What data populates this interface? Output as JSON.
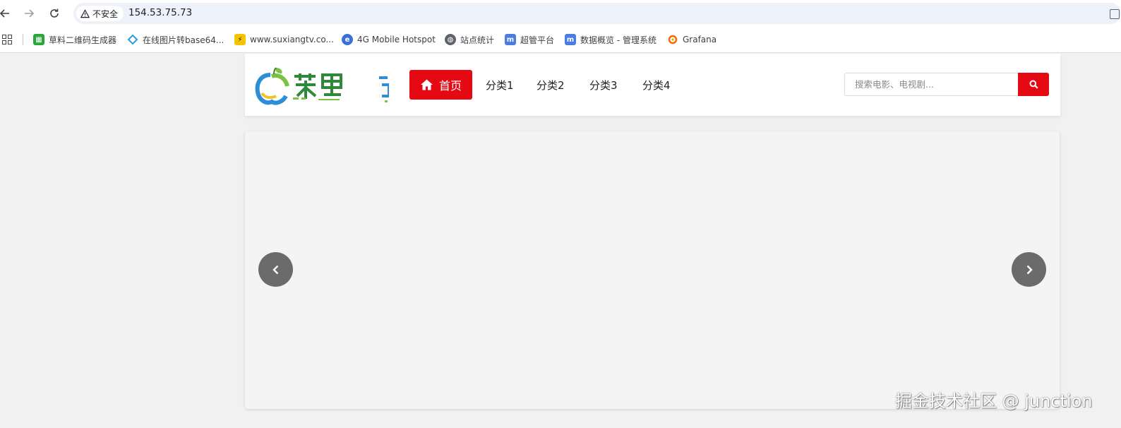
{
  "browser": {
    "security_label": "不安全",
    "url": "154.53.75.73",
    "bookmarks": [
      {
        "label": "草料二维码生成器",
        "icon": "qr-icon",
        "color": "#2aa63a"
      },
      {
        "label": "在线图片转base64...",
        "icon": "diamond-icon",
        "color": "#2f9be0"
      },
      {
        "label": "www.suxiangtv.co...",
        "icon": "bolt-icon",
        "color": "#f5c400"
      },
      {
        "label": "4G Mobile Hotspot",
        "icon": "globe-e-icon",
        "color": "#3b6fd8"
      },
      {
        "label": "站点统计",
        "icon": "globe-icon",
        "color": "#5f6368"
      },
      {
        "label": "超管平台",
        "icon": "m-icon",
        "color": "#4a7ddf"
      },
      {
        "label": "数据概览 - 管理系统",
        "icon": "m-icon",
        "color": "#4a7ddf"
      },
      {
        "label": "Grafana",
        "icon": "grafana-icon",
        "color": "#f46800"
      }
    ]
  },
  "site": {
    "nav": {
      "home_label": "首页",
      "categories": [
        "分类1",
        "分类2",
        "分类3",
        "分类4"
      ]
    },
    "search": {
      "placeholder": "搜索电影、电视剧..."
    },
    "accent_color": "#e50914"
  },
  "watermark": "掘金技术社区 @ junction"
}
